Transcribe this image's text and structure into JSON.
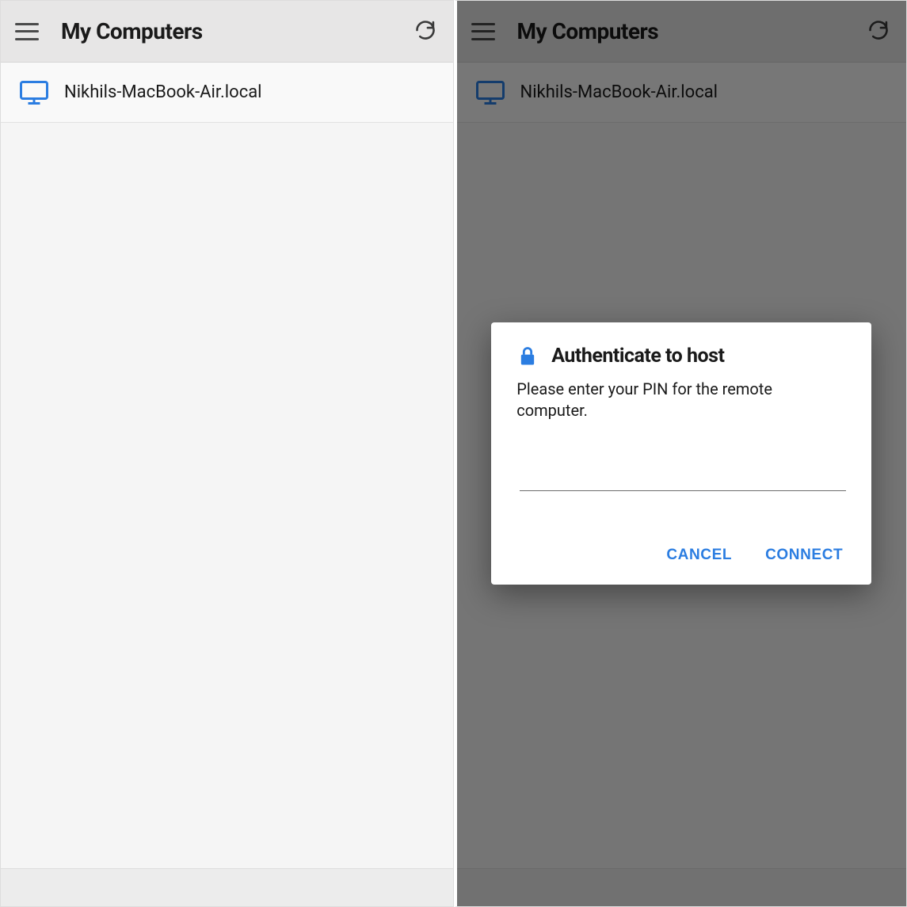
{
  "left": {
    "header": {
      "title": "My Computers"
    },
    "list": {
      "items": [
        {
          "name": "Nikhils-MacBook-Air.local"
        }
      ]
    }
  },
  "right": {
    "header": {
      "title": "My Computers"
    },
    "list": {
      "items": [
        {
          "name": "Nikhils-MacBook-Air.local"
        }
      ]
    },
    "dialog": {
      "title": "Authenticate to host",
      "message": "Please enter your PIN for the remote computer.",
      "pin_value": "",
      "cancel_label": "CANCEL",
      "connect_label": "CONNECT"
    }
  },
  "colors": {
    "accent_blue": "#2b7de1"
  }
}
